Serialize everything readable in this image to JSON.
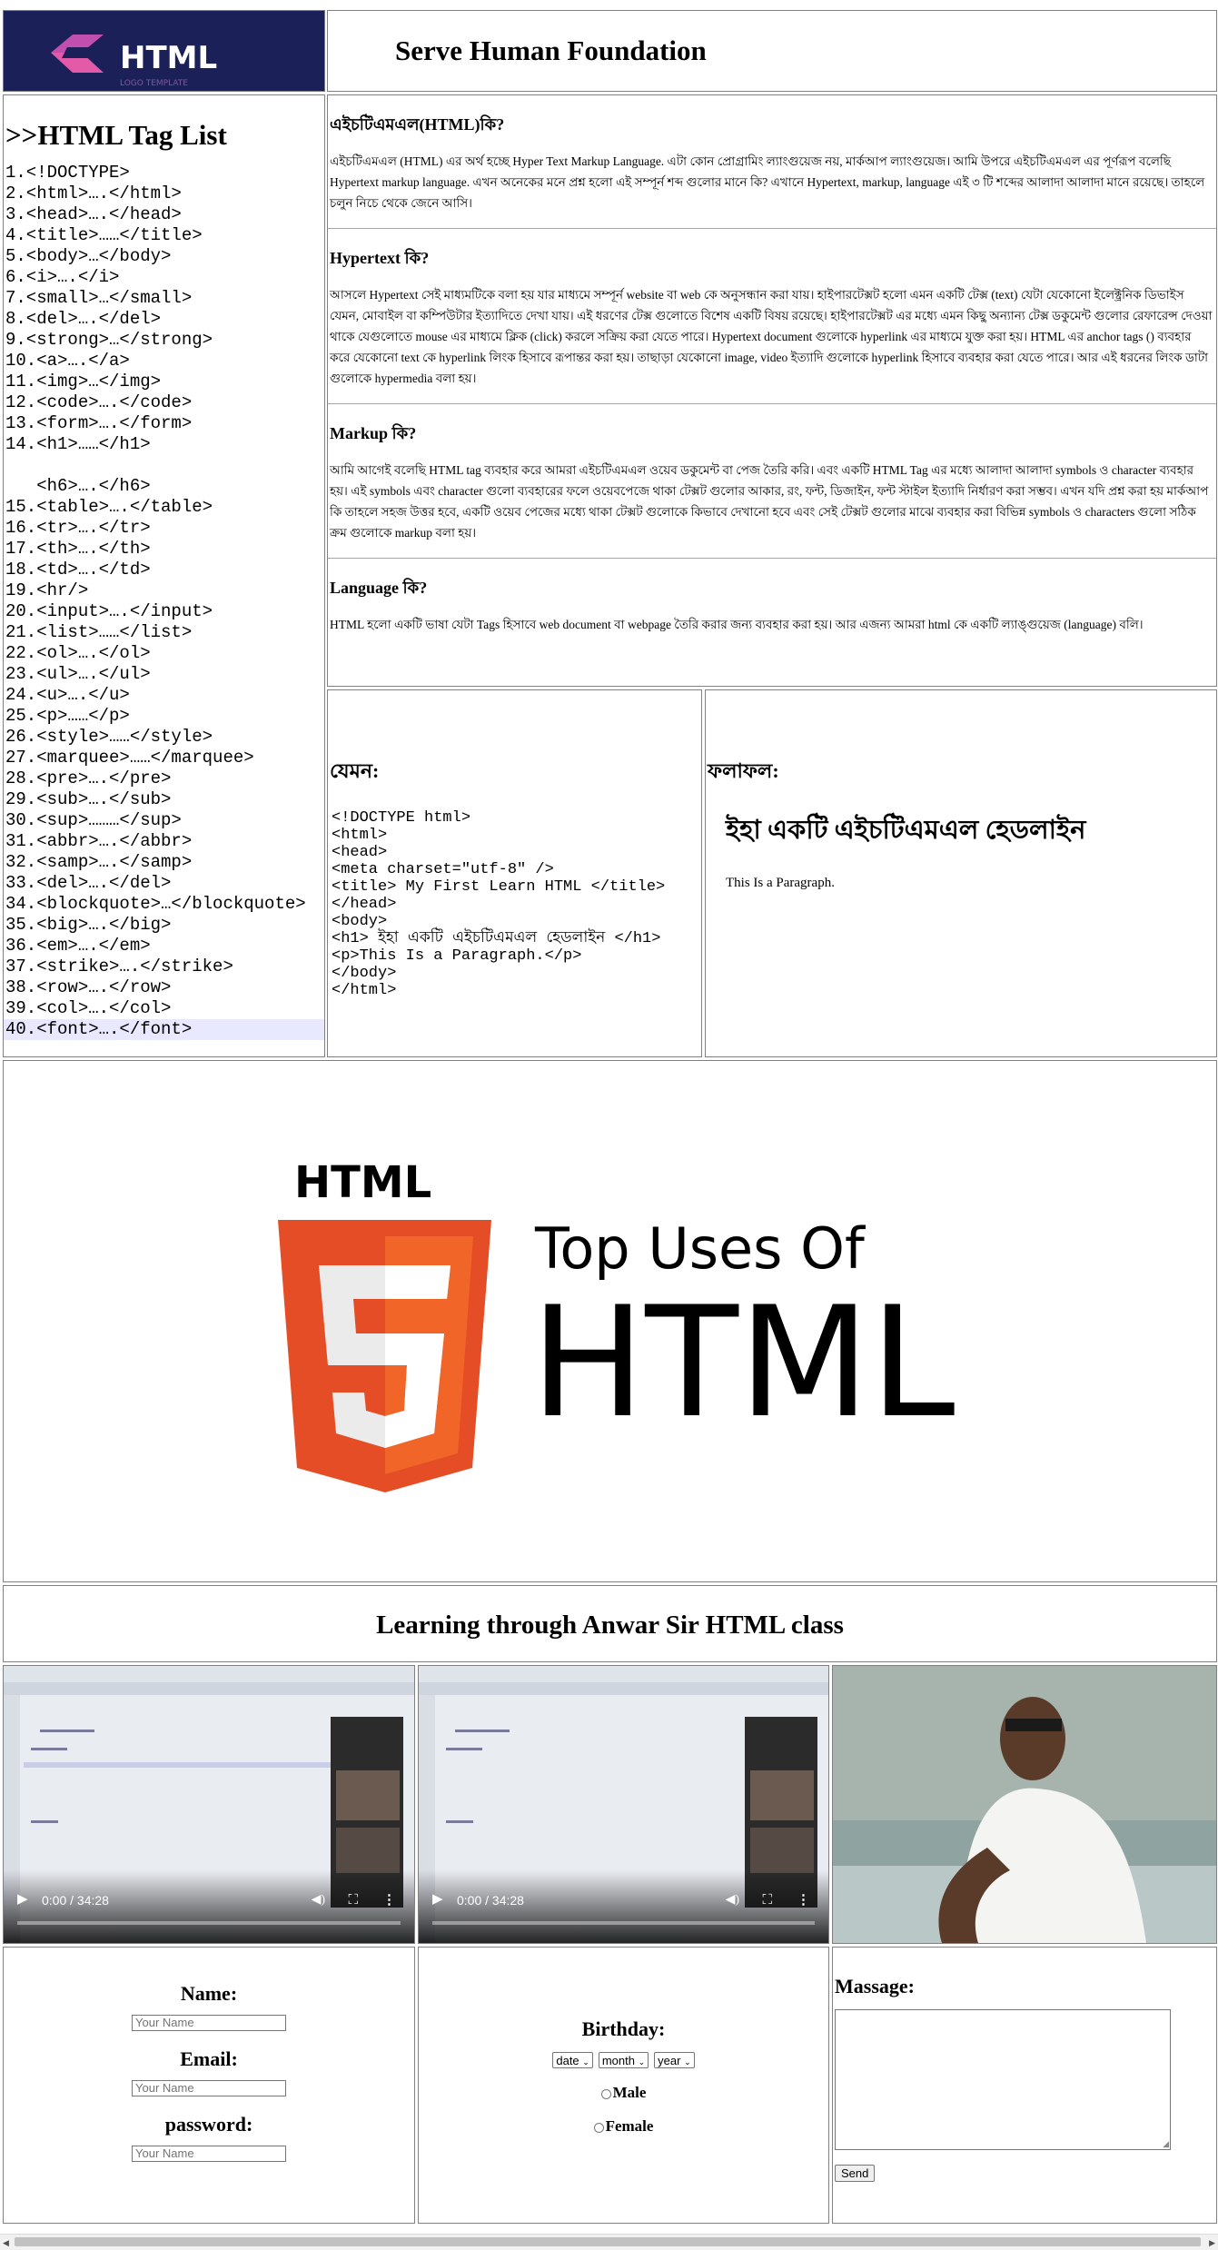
{
  "header": {
    "logo_text": "HTML",
    "logo_sub": "LOGO TEMPLATE",
    "title": "Serve Human Foundation"
  },
  "taglist": {
    "title": ">>HTML Tag List",
    "items": [
      "1.<!DOCTYPE>",
      "2.<html>….</html>",
      "3.<head>….</head>",
      "4.<title>……</title>",
      "5.<body>…</body>",
      "6.<i>….</i>",
      "7.<small>…</small>",
      "8.<del>….</del>",
      "9.<strong>…</strong>",
      "10.<a>….</a>",
      "11.<img>…</img>",
      "12.<code>….</code>",
      "13.<form>….</form>",
      "14.<h1>……</h1>",
      "",
      "   <h6>….</h6>",
      "15.<table>….</table>",
      "16.<tr>….</tr>",
      "17.<th>….</th>",
      "18.<td>….</td>",
      "19.<hr/>",
      "20.<input>….</input>",
      "21.<list>……</list>",
      "22.<ol>….</ol>",
      "23.<ul>….</ul>",
      "24.<u>….</u>",
      "25.<p>……</p>",
      "26.<style>……</style>",
      "27.<marquee>……</marquee>",
      "28.<pre>….</pre>",
      "29.<sub>….</sub>",
      "30.<sup>………</sup>",
      "31.<abbr>….</abbr>",
      "32.<samp>….</samp>",
      "33.<del>….</del>",
      "34.<blockquote>…</blockquote>",
      "35.<big>….</big>",
      "36.<em>….</em>",
      "37.<strike>….</strike>",
      "38.<row>….</row>",
      "39.<col>….</col>",
      "40.<font>….</font>"
    ]
  },
  "article": {
    "sections": [
      {
        "heading": "এইচটিএমএল(HTML)কি?",
        "body": "এইচটিএমএল (HTML) এর অর্থ হচ্ছে Hyper Text Markup Language. এটা কোন প্রোগ্রামিং ল্যাংগুয়েজ নয়, মার্কআপ ল্যাংগুয়েজ। আমি উপরে এইচটিএমএল এর পূর্ণরূপ বলেছি Hypertext markup language. এখন অনেকের মনে প্রশ্ন হলো এই সম্পূর্ন শব্দ গুলোর মানে কি? এখানে Hypertext, markup, language এই ৩ টি শব্দের আলাদা আলাদা মানে রয়েছে। তাহলে চলুন নিচে থেকে জেনে আসি।"
      },
      {
        "heading": "Hypertext কি?",
        "body": "আসলে Hypertext সেই মাধ্যমটিকে বলা হয় যার মাধ্যমে সম্পূর্ন website বা web কে অনুসন্ধান করা যায়। হাইপারটেক্সট হলো এমন একটি টেক্স (text) যেটা যেকোনো ইলেক্ট্রনিক ডিভাইস যেমন, মোবাইল বা কম্পিউটার ইত্যাদিতে দেখা যায়। এই ধরণের টেক্স গুলোতে বিশেষ একটি বিষয় রয়েছে। হাইপারটেক্সট এর মধ্যে এমন কিছু অন্যান্য টেক্স ডকুমেন্ট গুলোর রেফারেন্স দেওয়া থাকে যেগুলোতে mouse এর মাধ্যমে ক্লিক (click) করলে সক্রিয় করা যেতে পারে। Hypertext document গুলোকে hyperlink এর মাধ্যমে যুক্ত করা হয়। HTML এর anchor tags () ব্যবহার করে যেকোনো text কে hyperlink লিংক হিসাবে রূপান্তর করা হয়। তাছাড়া যেকোনো image, video ইত্যাদি গুলোকে hyperlink হিসাবে ব্যবহার করা যেতে পারে। আর এই ধরনের লিংক ডাটা গুলোকে hypermedia বলা হয়।"
      },
      {
        "heading": "Markup কি?",
        "body": "আমি আগেই বলেছি HTML tag ব্যবহার করে আমরা এইচটিএমএল ওয়েব ডকুমেন্ট বা পেজ তৈরি করি। এবং একটি HTML Tag এর মধ্যে আলাদা আলাদা symbols ও character ব্যবহার হয়। এই symbols এবং character গুলো ব্যবহারের ফলে ওয়েবপেজে থাকা টেক্সট গুলোর আকার, রং, ফন্ট, ডিজাইন, ফন্ট স্টাইল ইত্যাদি নির্ধারণ করা সম্ভব। এখন যদি প্রশ্ন করা হয় মার্কআপ কি তাহলে সহজ উত্তর হবে, একটি ওয়েব পেজের মধ্যে থাকা টেক্সট গুলোকে কিভাবে দেখানো হবে এবং সেই টেক্সট গুলোর মাঝে ব্যবহার করা বিভিন্ন symbols ও characters গুলো সঠিক ক্রম গুলোকে markup বলা হয়।"
      },
      {
        "heading": "Language কি?",
        "body": "HTML হলো একটি ভাষা যেটা Tags হিসাবে web document বা webpage তৈরি করার জন্য ব্যবহার করা হয়। আর এজন্য আমরা html কে একটি ল্যাঙ্গুয়েজ (language) বলি।"
      }
    ]
  },
  "example": {
    "heading": "যেমন:",
    "code": "<!DOCTYPE html>\n<html>\n<head>\n<meta charset=\"utf-8\" />\n<title> My First Learn HTML </title>\n</head>\n<body>\n<h1> ইহা একটি এইচটিএমএল হেডলাইন </h1>\n<p>This Is a Paragraph.</p>\n</body>\n</html>"
  },
  "result": {
    "heading": "ফলাফল:",
    "h1": "ইহা একটি এইচটিএমএল হেডলাইন",
    "p": "This Is a Paragraph."
  },
  "banner": {
    "logo_word": "HTML",
    "shield_digit": "5",
    "line1": "Top Uses Of",
    "line2": "HTML"
  },
  "learning": {
    "title": "Learning through Anwar Sir HTML class",
    "videos": [
      {
        "time": "0:00 / 34:28"
      },
      {
        "time": "0:00 / 34:28"
      }
    ]
  },
  "form": {
    "name_label": "Name:",
    "name_placeholder": "Your Name",
    "email_label": "Email:",
    "email_placeholder": "Your Name",
    "password_label": "password:",
    "password_placeholder": "Your Name",
    "birthday_label": "Birthday:",
    "date_select": "date",
    "month_select": "month",
    "year_select": "year",
    "male_label": "Male",
    "female_label": "Female",
    "message_label": "Massage:",
    "send_label": "Send"
  },
  "colors": {
    "logo_bg": "#1c2058",
    "html5_orange": "#e44d26",
    "html5_dark_orange": "#f16529",
    "list_highlight": "#e8e8ff"
  }
}
